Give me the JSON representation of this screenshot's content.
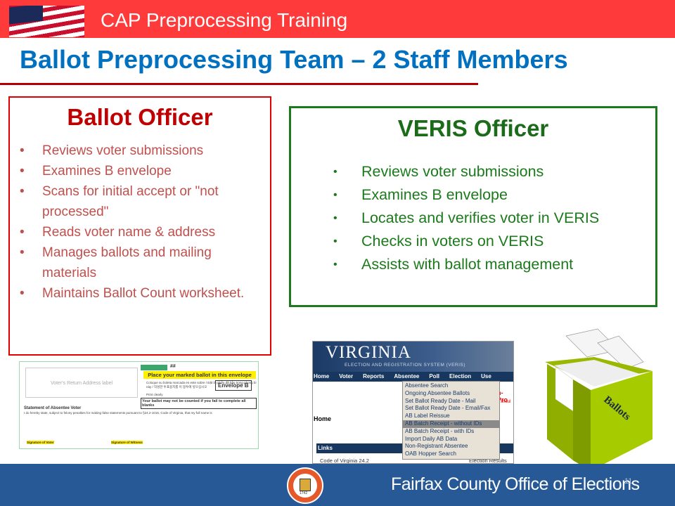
{
  "header": {
    "title": "CAP Preprocessing Training",
    "flag_icon": "us-flag"
  },
  "slide_title": "Ballot Preprocessing Team – 2 Staff Members",
  "colors": {
    "header": "#ff3a3a",
    "title": "#0070c0",
    "ballot_officer": "#c00000",
    "veris_officer": "#1b7a1b",
    "footer": "#265996"
  },
  "ballot_officer": {
    "title": "Ballot Officer",
    "items": [
      "Reviews voter submissions",
      "Examines B envelope",
      "Scans for initial accept or \"not processed\"",
      "Reads voter name & address",
      "Manages ballots and mailing materials",
      "Maintains Ballot Count worksheet."
    ]
  },
  "veris_officer": {
    "title": "VERIS Officer",
    "items": [
      "Reviews voter submissions",
      "Examines B envelope",
      "Locates and verifies voter in VERIS",
      "Checks in voters on VERIS",
      "Assists with ballot management"
    ]
  },
  "bullet": "•",
  "envelope": {
    "hash": "##",
    "address_label": "Voter's Return Address label",
    "place_ballot": "Place your marked ballot in this envelope",
    "translations": "Coloque su boleta marcada en este sobre / Đặt lá phiếu đã bầu trong phong bì này / 작성한 투표용지를 이 봉투에 넣으십시오",
    "print_clearly": "Print clearly",
    "envelope_label": "Envelope B",
    "warning": "Your ballot may not be counted if you fail to complete all blanks",
    "statement_title": "Statement of Absentee Voter",
    "statement_text": "I do hereby state, subject to felony penalties for making false statements pursuant to §24.2-1016, Code of Virginia, that my full name is",
    "sig_voter": "Signature of Voter",
    "sig_witness": "Signature of Witness"
  },
  "veris": {
    "banner_title": "VIRGINIA",
    "banner_subtitle": "ELECTION AND REGISTRATION SYSTEM (VERIS)",
    "nav": [
      "Home",
      "Voter",
      "Reports",
      "Absentee",
      "Poll",
      "Election",
      "Use"
    ],
    "menu": [
      "Absentee Search",
      "Ongoing Absentee Ballots",
      "Set Ballot Ready Date - Mail",
      "Set Ballot Ready Date - Email/Fax",
      "AB Label Reissue",
      "AB Batch Receipt - without IDs",
      "AB Batch Receipt - with IDs",
      "Import Daily AB Data",
      "Non-Registrant Absentee",
      "OAB Hopper Search"
    ],
    "selected_menu_index": 5,
    "red_text": "n-Pro",
    "red_subtext": "h shoul",
    "home_label": "Home",
    "links_label": "Links",
    "link_1": "Code of Virginia 24.2",
    "link_2": "Election Results"
  },
  "ballot_box": {
    "label": "Ballots"
  },
  "footer": {
    "text": "Fairfax County Office of Elections",
    "seal_year": "1742",
    "page_number": "11"
  }
}
